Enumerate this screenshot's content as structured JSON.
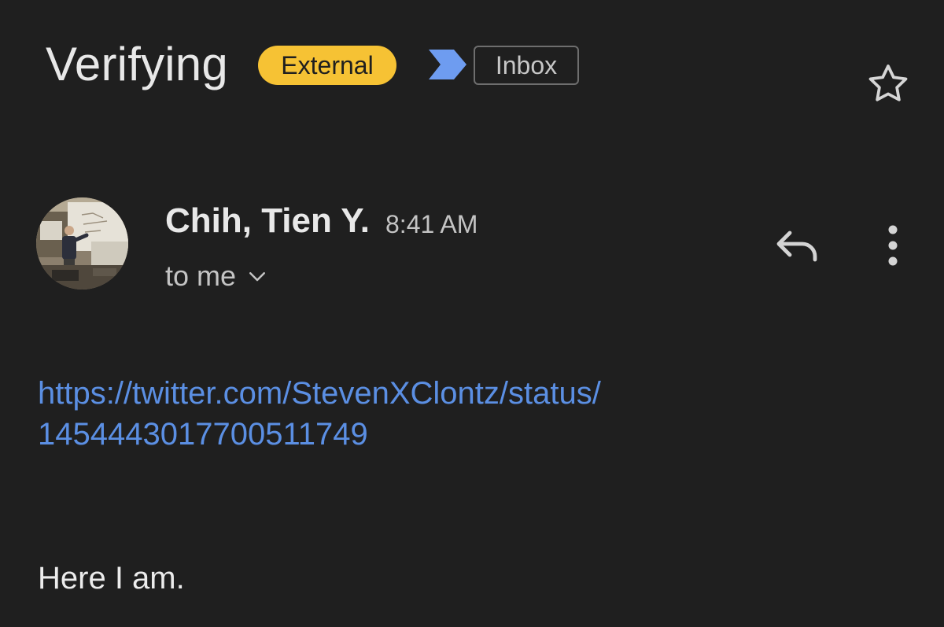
{
  "email": {
    "subject": "Verifying",
    "badge_external": "External",
    "label": "Inbox",
    "sender": "Chih, Tien Y.",
    "time": "8:41 AM",
    "recipients": "to me",
    "link_line1": "https://twitter.com/StevenXClontz/status/",
    "link_line2": "1454443017700511749",
    "body_text": "Here I am."
  },
  "icons": {
    "importance": "importance-marker-icon",
    "star": "star-outline-icon",
    "reply": "reply-icon",
    "more": "more-vertical-icon",
    "expand": "chevron-down-icon"
  },
  "colors": {
    "background": "#1f1f1f",
    "external_badge": "#f6c234",
    "importance_marker": "#6e9cf0",
    "link": "#5b8fe3",
    "text_primary": "#e8e8e8",
    "text_secondary": "#c4c4c4"
  }
}
